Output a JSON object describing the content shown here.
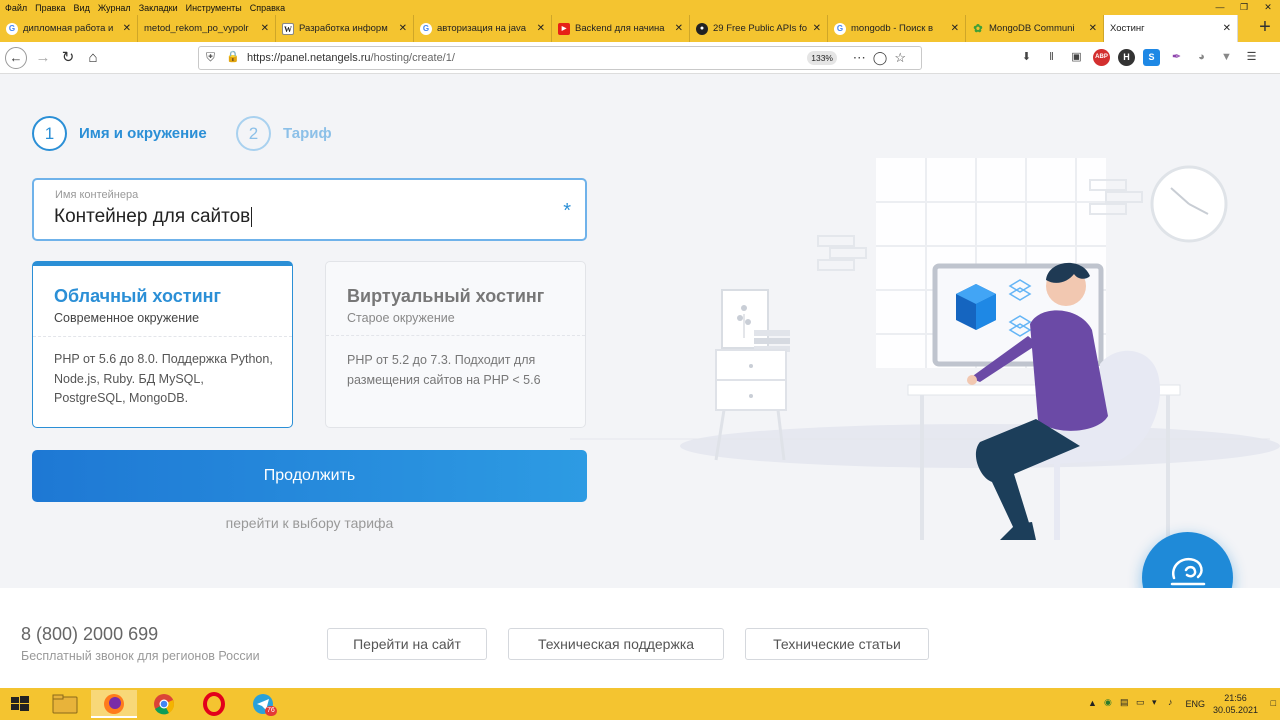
{
  "browser": {
    "menu": [
      "Файл",
      "Правка",
      "Вид",
      "Журнал",
      "Закладки",
      "Инструменты",
      "Справка"
    ],
    "tabs": [
      {
        "title": "дипломная работа и",
        "icon": "google-icon"
      },
      {
        "title": "metod_rekom_po_vypolr",
        "icon": "document-icon"
      },
      {
        "title": "Разработка информ",
        "icon": "wikipedia-icon"
      },
      {
        "title": "авторизация на java",
        "icon": "google-icon"
      },
      {
        "title": "Backend для начина",
        "icon": "youtube-icon"
      },
      {
        "title": "29 Free Public APIs fo",
        "icon": "github-icon"
      },
      {
        "title": "mongodb - Поиск в",
        "icon": "google-icon"
      },
      {
        "title": "MongoDB Communi",
        "icon": "mongodb-icon"
      },
      {
        "title": "Хостинг",
        "icon": "none",
        "active": true
      }
    ],
    "url_host": "https://panel.netangels.ru",
    "url_path": "/hosting/create/1/",
    "zoom": "133%"
  },
  "steps": [
    {
      "number": "1",
      "label": "Имя и окружение",
      "active": true
    },
    {
      "number": "2",
      "label": "Тариф",
      "active": false
    }
  ],
  "container_field": {
    "label": "Имя контейнера",
    "value": "Контейнер для сайтов",
    "required_mark": "*"
  },
  "hosting_options": [
    {
      "title": "Облачный хостинг",
      "subtitle": "Современное окружение",
      "description": "PHP от 5.6 до 8.0. Поддержка Python, Node.js, Ruby. БД MySQL, PostgreSQL, MongoDB.",
      "selected": true
    },
    {
      "title": "Виртуальный хостинг",
      "subtitle": "Старое окружение",
      "description": "PHP от 5.2 до 7.3. Подходит для размещения сайтов на PHP < 5.6",
      "selected": false
    }
  ],
  "continue_button": "Продолжить",
  "tariff_link": "перейти к выбору тарифа",
  "footer": {
    "phone": "8 (800) 2000 699",
    "phone_note": "Бесплатный звонок для регионов России",
    "buttons": [
      "Перейти на сайт",
      "Техническая поддержка",
      "Технические статьи"
    ]
  },
  "taskbar": {
    "language": "ENG",
    "time": "21:56",
    "date": "30.05.2021",
    "telegram_badge": "76"
  },
  "colors": {
    "accent": "#2b8fd6",
    "browser_theme": "#f4c430",
    "page_bg": "#f3f4f7"
  }
}
